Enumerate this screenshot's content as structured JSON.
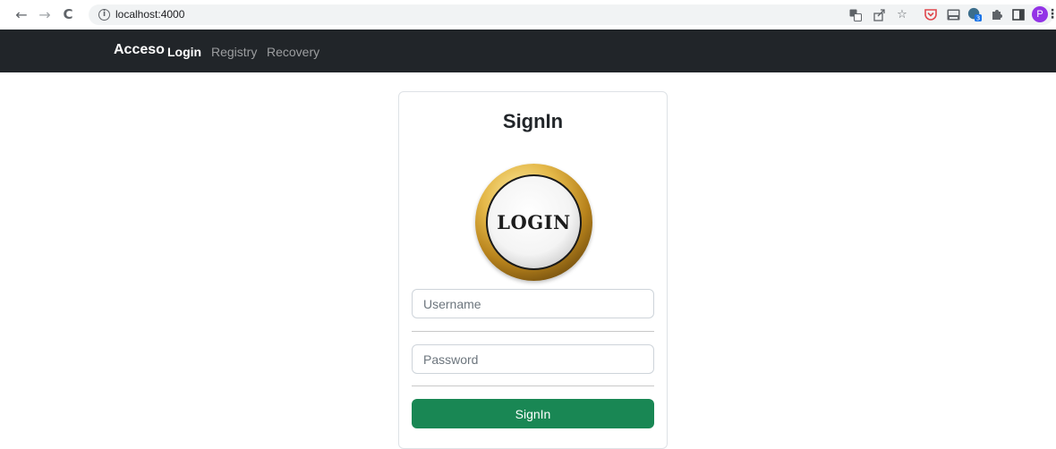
{
  "browser": {
    "url": "localhost:4000",
    "info_glyph": "i",
    "back_glyph": "←",
    "forward_glyph": "→",
    "reload_glyph": "C",
    "profile_initial": "P",
    "extension_badge": "3",
    "toolbar_icons": [
      "translate-icon",
      "share-icon",
      "bookmark-star-icon",
      "pocket-icon",
      "keyboard-icon",
      "extension-badge-icon",
      "puzzle-icon",
      "sidepanel-icon",
      "profile-avatar",
      "menu-dots-icon"
    ]
  },
  "navbar": {
    "brand": "Acceso",
    "links": [
      {
        "label": "Login",
        "active": true
      },
      {
        "label": "Registry",
        "active": false
      },
      {
        "label": "Recovery",
        "active": false
      }
    ]
  },
  "card": {
    "title": "SignIn",
    "logo_text": "LOGIN",
    "username_placeholder": "Username",
    "password_placeholder": "Password",
    "submit_label": "SignIn"
  },
  "colors": {
    "navbar_bg": "#212529",
    "primary_button": "#198754",
    "logo_gold": "#d4a640"
  }
}
